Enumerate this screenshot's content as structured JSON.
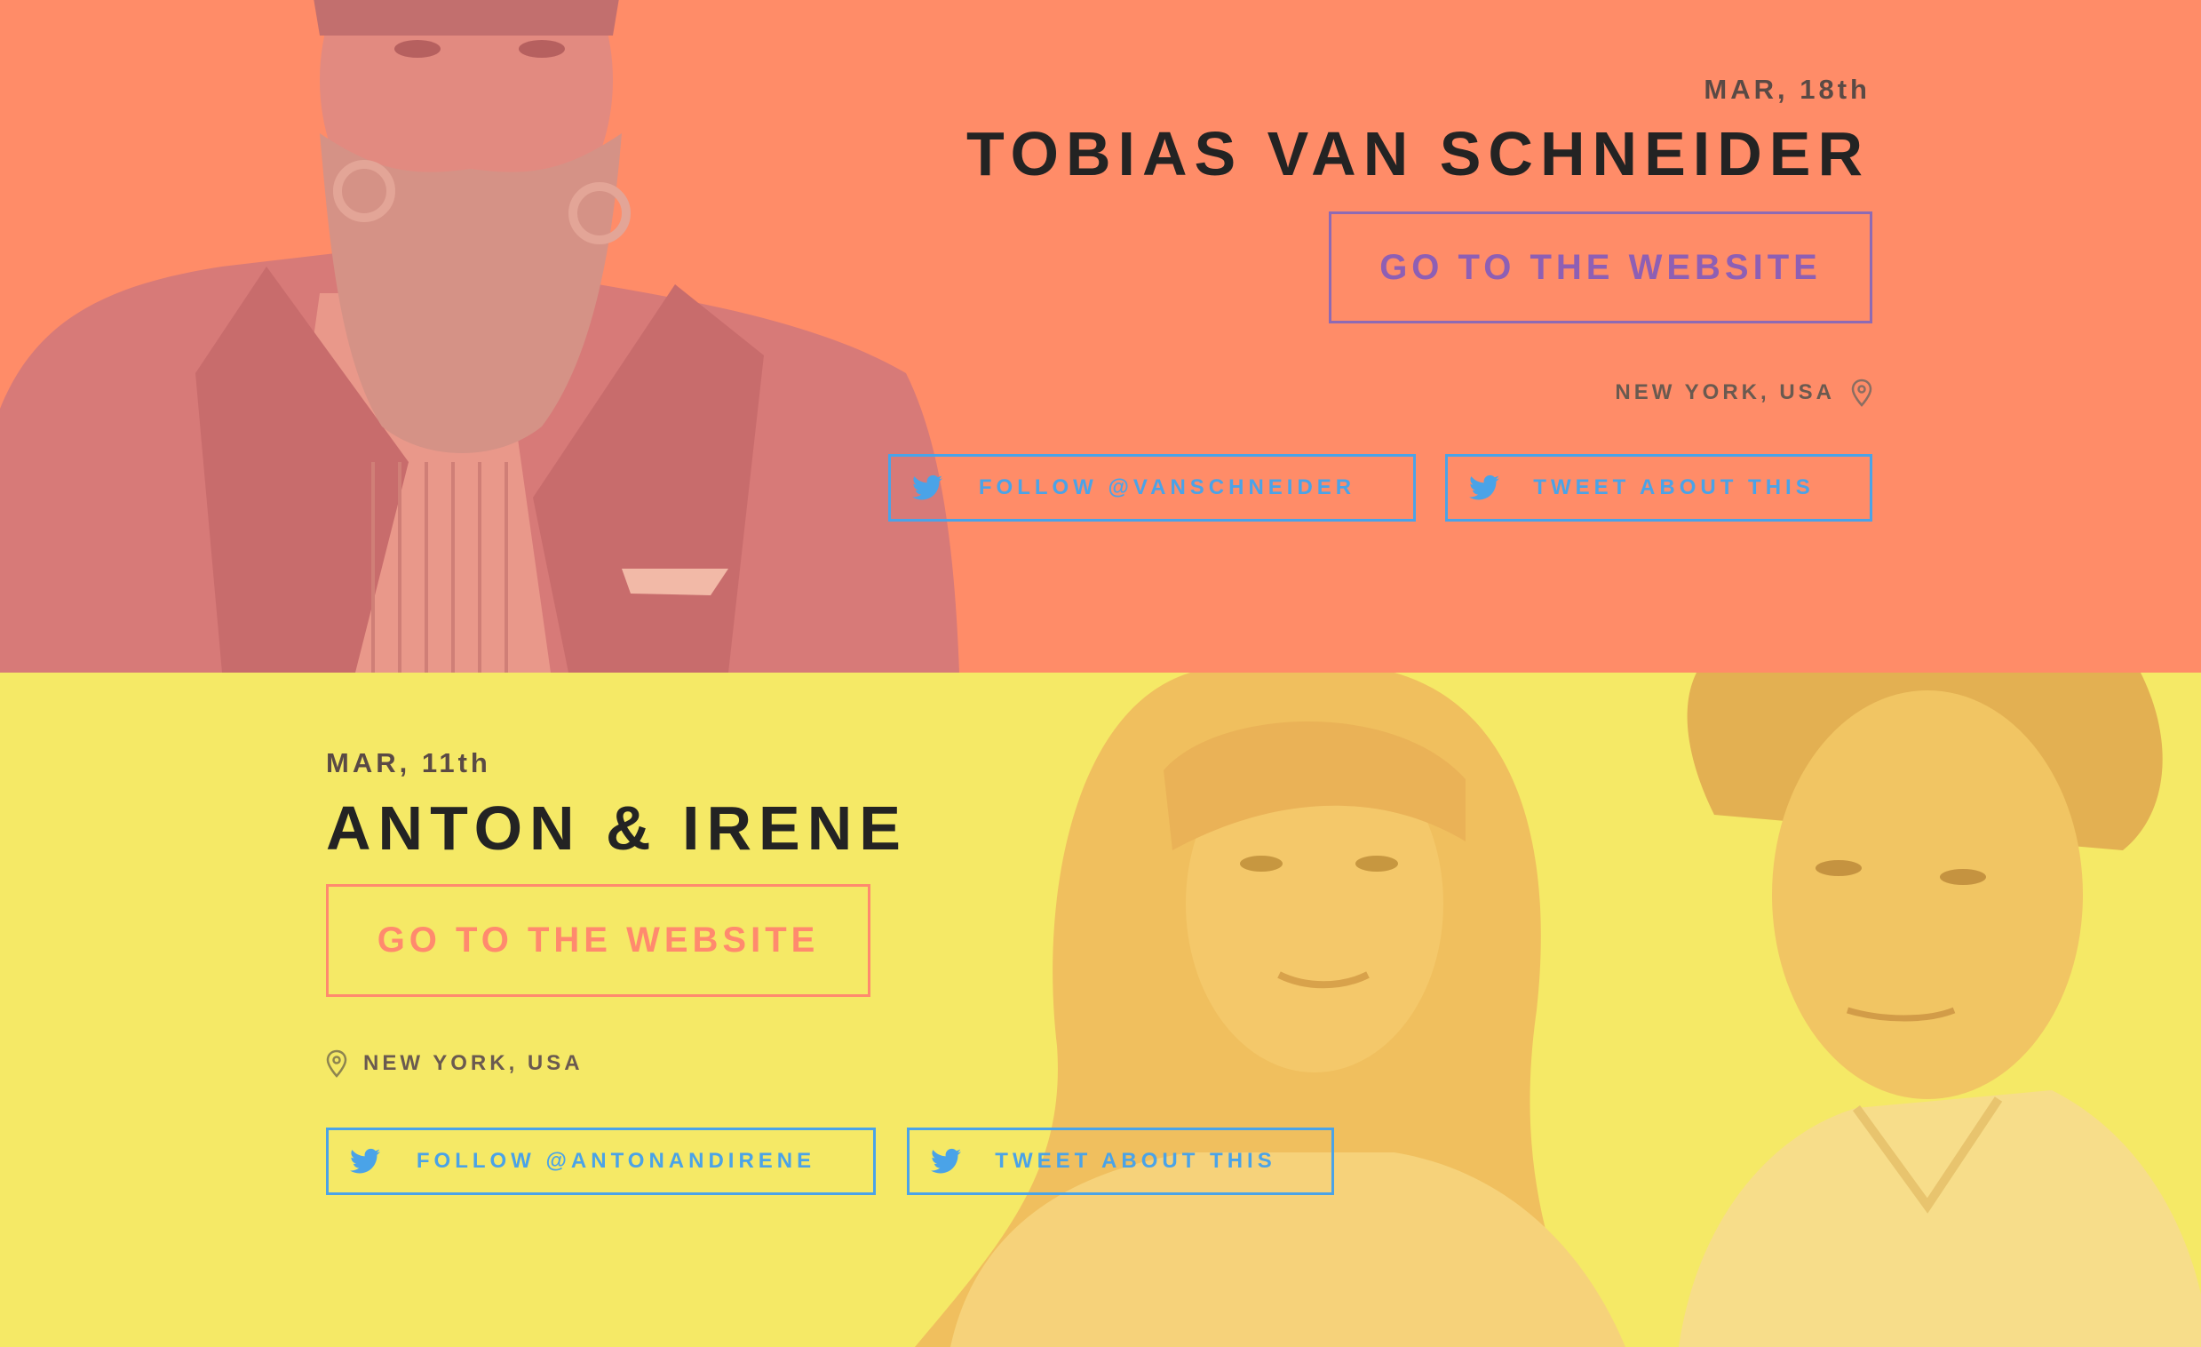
{
  "entries": [
    {
      "date": "MAR, 18th",
      "name": "TOBIAS VAN SCHNEIDER",
      "website_label": "GO TO THE WEBSITE",
      "location": "NEW YORK, USA",
      "follow_label": "FOLLOW @VANSCHNEIDER",
      "tweet_label": "TWEET ABOUT THIS",
      "background_color": "#ff8c68",
      "website_button_color": "#8e5fb4"
    },
    {
      "date": "MAR, 11th",
      "name": "ANTON & IRENE",
      "website_label": "GO TO THE WEBSITE",
      "location": "NEW YORK, USA",
      "follow_label": "FOLLOW @ANTONANDIRENE",
      "tweet_label": "TWEET ABOUT THIS",
      "background_color": "#f5e966",
      "website_button_color": "#ff8a6e"
    }
  ],
  "icons": {
    "location": "map-pin-icon",
    "twitter": "twitter-bird-icon"
  },
  "colors": {
    "twitter_blue": "#4aa3e8",
    "heading": "#232323"
  }
}
